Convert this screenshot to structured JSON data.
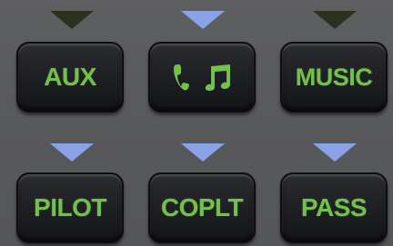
{
  "panel": {
    "row1": {
      "indicators": [
        {
          "state": "off",
          "color": "#2c301f"
        },
        {
          "state": "on",
          "color": "#8aa2e6"
        },
        {
          "state": "off",
          "color": "#2c301f"
        }
      ],
      "keys": [
        {
          "label": "AUX"
        },
        {
          "icons": [
            "phone-icon",
            "music-note-icon"
          ]
        },
        {
          "label": "MUSIC"
        }
      ]
    },
    "row2": {
      "indicators": [
        {
          "state": "on",
          "color": "#8aa2e6"
        },
        {
          "state": "on",
          "color": "#8aa2e6"
        },
        {
          "state": "on",
          "color": "#8aa2e6"
        }
      ],
      "keys": [
        {
          "label": "PILOT"
        },
        {
          "label": "COPLT"
        },
        {
          "label": "PASS"
        }
      ]
    },
    "colors": {
      "label_green": "#73c14b",
      "indicator_on": "#8aa2e6",
      "indicator_off": "#2c301f",
      "background": "#5a5b5d"
    }
  }
}
